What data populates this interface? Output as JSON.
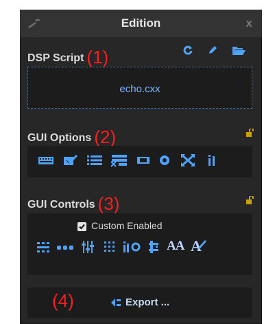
{
  "window": {
    "title": "Edition",
    "close_label": "x"
  },
  "dsp_script": {
    "heading": "DSP Script",
    "annotation": "(1)",
    "file_name": "echo.cxx",
    "icons": [
      "refresh-icon",
      "edit-pencil-icon",
      "open-folder-icon"
    ]
  },
  "gui_options": {
    "heading": "GUI Options",
    "annotation": "(2)",
    "icons": [
      "keyboard-icon",
      "checkbox-list-icon",
      "list-icon",
      "list-remove-icon",
      "battery-icon",
      "circle-icon",
      "crossed-arrows-icon",
      "pause-bars-icon"
    ]
  },
  "gui_controls": {
    "heading": "GUI Controls",
    "annotation": "(3)",
    "custom_enabled_label": "Custom Enabled",
    "custom_enabled_checked": true,
    "icons": [
      "grid-icon",
      "dots-icon",
      "sliders-icon",
      "matrix-icon",
      "knob-icon",
      "vertical-slider-icon",
      "font-size-icon",
      "font-style-icon"
    ],
    "font_size_glyph": "AA",
    "font_style_glyph": "A"
  },
  "export": {
    "annotation": "(4)",
    "label": "Export ..."
  },
  "colors": {
    "panel_bg": "#272727",
    "titlebar_bg": "#333333",
    "box_bg": "#1c1c1c",
    "accent": "#7fb8ff",
    "annotation": "#ff1e1e"
  }
}
